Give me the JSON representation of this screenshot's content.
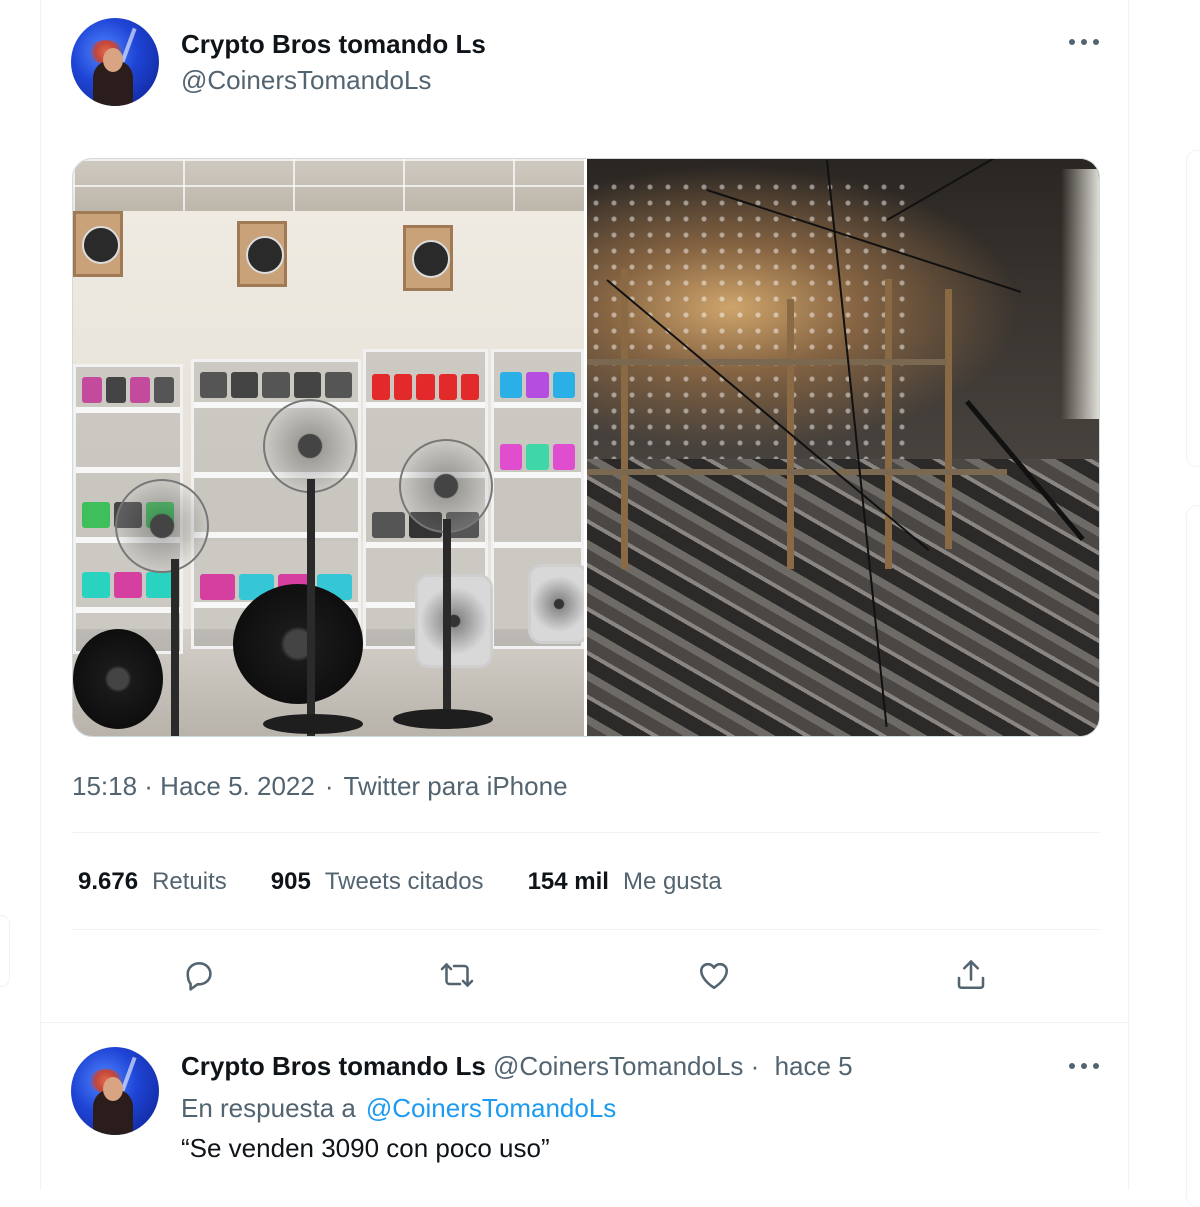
{
  "tweet": {
    "author": {
      "display_name": "Crypto Bros tomando Ls",
      "handle": "@CoinersTomandoLs"
    },
    "media": [
      {
        "alt": ""
      },
      {
        "alt": ""
      }
    ],
    "timestamp": "15:18 · Hace 5. 2022",
    "separator": "·",
    "source": "Twitter para iPhone",
    "stats": [
      {
        "value": "9.676",
        "label": "Retuits"
      },
      {
        "value": "905",
        "label": "Tweets citados"
      },
      {
        "value": "154 mil",
        "label": "Me gusta"
      }
    ],
    "actions": [
      {
        "icon": "reply-icon"
      },
      {
        "icon": "retweet-icon"
      },
      {
        "icon": "like-icon"
      },
      {
        "icon": "share-icon"
      }
    ]
  },
  "reply": {
    "author": {
      "display_name": "Crypto Bros tomando Ls",
      "handle": "@CoinersTomandoLs"
    },
    "separator": "·",
    "time": "hace 5",
    "in_reply_prefix": "En respuesta a",
    "in_reply_mention": "@CoinersTomandoLs",
    "text": "“Se venden 3090 con poco uso”"
  },
  "colors": {
    "text_primary": "#0f1419",
    "text_secondary": "#536471",
    "link": "#1d9bf0",
    "border": "#eff3f4"
  }
}
